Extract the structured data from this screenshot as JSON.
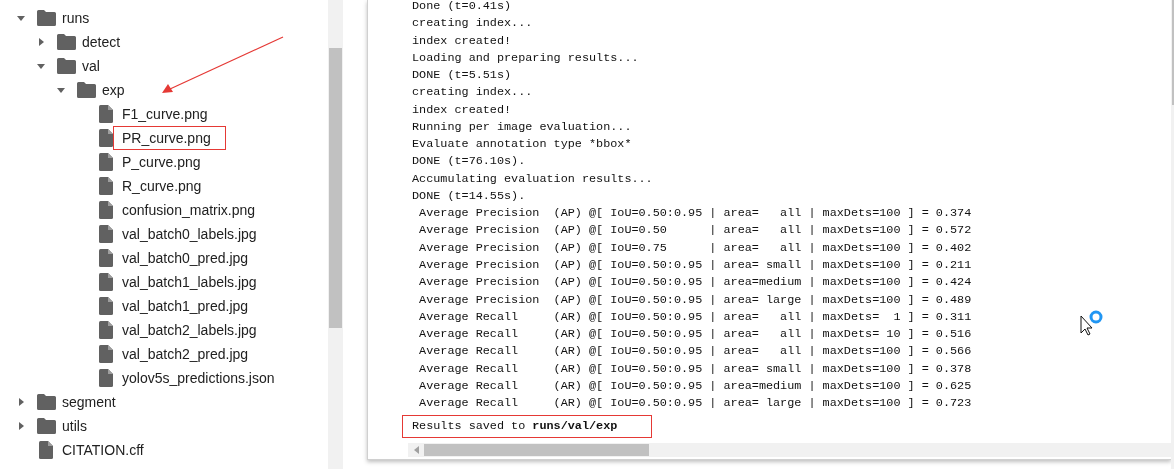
{
  "file_tree": [
    {
      "kind": "folder",
      "name": "runs",
      "expanded": true,
      "boxed": false,
      "children": [
        {
          "kind": "folder",
          "name": "detect",
          "expanded": false,
          "boxed": false
        },
        {
          "kind": "folder",
          "name": "val",
          "expanded": true,
          "boxed": false,
          "children": [
            {
              "kind": "folder",
              "name": "exp",
              "expanded": true,
              "boxed": false,
              "children": [
                {
                  "kind": "file",
                  "name": "F1_curve.png",
                  "boxed": false
                },
                {
                  "kind": "file",
                  "name": "PR_curve.png",
                  "boxed": true
                },
                {
                  "kind": "file",
                  "name": "P_curve.png",
                  "boxed": false
                },
                {
                  "kind": "file",
                  "name": "R_curve.png",
                  "boxed": false
                },
                {
                  "kind": "file",
                  "name": "confusion_matrix.png",
                  "boxed": false
                },
                {
                  "kind": "file",
                  "name": "val_batch0_labels.jpg",
                  "boxed": false
                },
                {
                  "kind": "file",
                  "name": "val_batch0_pred.jpg",
                  "boxed": false
                },
                {
                  "kind": "file",
                  "name": "val_batch1_labels.jpg",
                  "boxed": false
                },
                {
                  "kind": "file",
                  "name": "val_batch1_pred.jpg",
                  "boxed": false
                },
                {
                  "kind": "file",
                  "name": "val_batch2_labels.jpg",
                  "boxed": false
                },
                {
                  "kind": "file",
                  "name": "val_batch2_pred.jpg",
                  "boxed": false
                },
                {
                  "kind": "file",
                  "name": "yolov5s_predictions.json",
                  "boxed": false
                }
              ]
            }
          ]
        }
      ]
    },
    {
      "kind": "folder",
      "name": "segment",
      "expanded": false,
      "boxed": false
    },
    {
      "kind": "folder",
      "name": "utils",
      "expanded": false,
      "boxed": false
    },
    {
      "kind": "file",
      "name": "CITATION.cff",
      "boxed": false
    }
  ],
  "output": [
    {
      "text": "Done (t=0.41s)",
      "boxed": false
    },
    {
      "text": "creating index...",
      "boxed": false
    },
    {
      "text": "index created!",
      "boxed": false
    },
    {
      "text": "Loading and preparing results...",
      "boxed": false
    },
    {
      "text": "DONE (t=5.51s)",
      "boxed": false
    },
    {
      "text": "creating index...",
      "boxed": false
    },
    {
      "text": "index created!",
      "boxed": false
    },
    {
      "text": "Running per image evaluation...",
      "boxed": false
    },
    {
      "text": "Evaluate annotation type *bbox*",
      "boxed": false
    },
    {
      "text": "DONE (t=76.10s).",
      "boxed": false
    },
    {
      "text": "Accumulating evaluation results...",
      "boxed": false
    },
    {
      "text": "DONE (t=14.55s).",
      "boxed": false
    },
    {
      "text": " Average Precision  (AP) @[ IoU=0.50:0.95 | area=   all | maxDets=100 ] = 0.374",
      "boxed": false
    },
    {
      "text": " Average Precision  (AP) @[ IoU=0.50      | area=   all | maxDets=100 ] = 0.572",
      "boxed": false
    },
    {
      "text": " Average Precision  (AP) @[ IoU=0.75      | area=   all | maxDets=100 ] = 0.402",
      "boxed": false
    },
    {
      "text": " Average Precision  (AP) @[ IoU=0.50:0.95 | area= small | maxDets=100 ] = 0.211",
      "boxed": false
    },
    {
      "text": " Average Precision  (AP) @[ IoU=0.50:0.95 | area=medium | maxDets=100 ] = 0.424",
      "boxed": false
    },
    {
      "text": " Average Precision  (AP) @[ IoU=0.50:0.95 | area= large | maxDets=100 ] = 0.489",
      "boxed": false
    },
    {
      "text": " Average Recall     (AR) @[ IoU=0.50:0.95 | area=   all | maxDets=  1 ] = 0.311",
      "boxed": false
    },
    {
      "text": " Average Recall     (AR) @[ IoU=0.50:0.95 | area=   all | maxDets= 10 ] = 0.516",
      "boxed": false
    },
    {
      "text": " Average Recall     (AR) @[ IoU=0.50:0.95 | area=   all | maxDets=100 ] = 0.566",
      "boxed": false
    },
    {
      "text": " Average Recall     (AR) @[ IoU=0.50:0.95 | area= small | maxDets=100 ] = 0.378",
      "boxed": false
    },
    {
      "text": " Average Recall     (AR) @[ IoU=0.50:0.95 | area=medium | maxDets=100 ] = 0.625",
      "boxed": false
    },
    {
      "text": " Average Recall     (AR) @[ IoU=0.50:0.95 | area= large | maxDets=100 ] = 0.723",
      "boxed": false
    },
    {
      "text": "Results saved to ",
      "path": "runs/val/exp",
      "boxed": true
    }
  ]
}
